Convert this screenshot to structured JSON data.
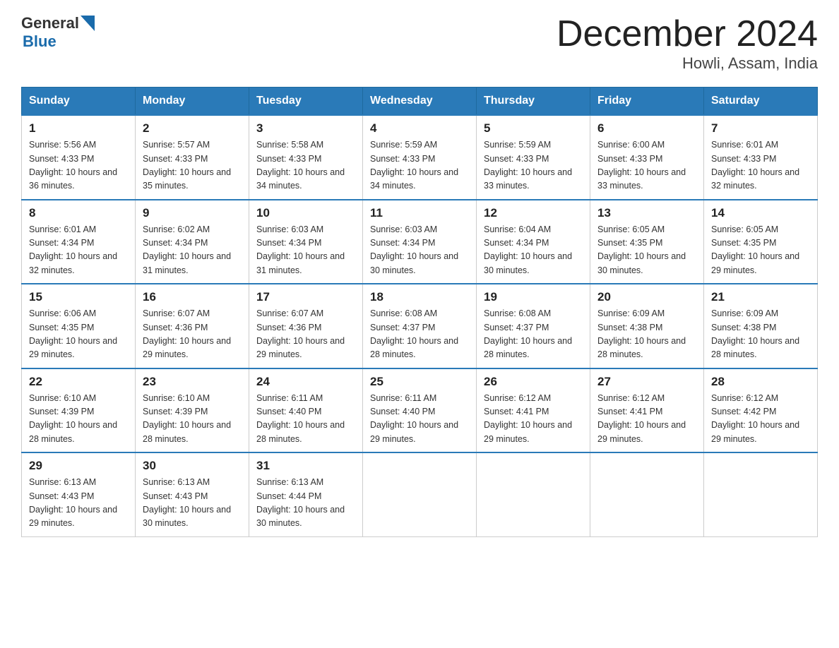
{
  "header": {
    "logo_general": "General",
    "logo_blue": "Blue",
    "month": "December 2024",
    "location": "Howli, Assam, India"
  },
  "days_of_week": [
    "Sunday",
    "Monday",
    "Tuesday",
    "Wednesday",
    "Thursday",
    "Friday",
    "Saturday"
  ],
  "weeks": [
    [
      {
        "day": 1,
        "sunrise": "5:56 AM",
        "sunset": "4:33 PM",
        "daylight": "10 hours and 36 minutes."
      },
      {
        "day": 2,
        "sunrise": "5:57 AM",
        "sunset": "4:33 PM",
        "daylight": "10 hours and 35 minutes."
      },
      {
        "day": 3,
        "sunrise": "5:58 AM",
        "sunset": "4:33 PM",
        "daylight": "10 hours and 34 minutes."
      },
      {
        "day": 4,
        "sunrise": "5:59 AM",
        "sunset": "4:33 PM",
        "daylight": "10 hours and 34 minutes."
      },
      {
        "day": 5,
        "sunrise": "5:59 AM",
        "sunset": "4:33 PM",
        "daylight": "10 hours and 33 minutes."
      },
      {
        "day": 6,
        "sunrise": "6:00 AM",
        "sunset": "4:33 PM",
        "daylight": "10 hours and 33 minutes."
      },
      {
        "day": 7,
        "sunrise": "6:01 AM",
        "sunset": "4:33 PM",
        "daylight": "10 hours and 32 minutes."
      }
    ],
    [
      {
        "day": 8,
        "sunrise": "6:01 AM",
        "sunset": "4:34 PM",
        "daylight": "10 hours and 32 minutes."
      },
      {
        "day": 9,
        "sunrise": "6:02 AM",
        "sunset": "4:34 PM",
        "daylight": "10 hours and 31 minutes."
      },
      {
        "day": 10,
        "sunrise": "6:03 AM",
        "sunset": "4:34 PM",
        "daylight": "10 hours and 31 minutes."
      },
      {
        "day": 11,
        "sunrise": "6:03 AM",
        "sunset": "4:34 PM",
        "daylight": "10 hours and 30 minutes."
      },
      {
        "day": 12,
        "sunrise": "6:04 AM",
        "sunset": "4:34 PM",
        "daylight": "10 hours and 30 minutes."
      },
      {
        "day": 13,
        "sunrise": "6:05 AM",
        "sunset": "4:35 PM",
        "daylight": "10 hours and 30 minutes."
      },
      {
        "day": 14,
        "sunrise": "6:05 AM",
        "sunset": "4:35 PM",
        "daylight": "10 hours and 29 minutes."
      }
    ],
    [
      {
        "day": 15,
        "sunrise": "6:06 AM",
        "sunset": "4:35 PM",
        "daylight": "10 hours and 29 minutes."
      },
      {
        "day": 16,
        "sunrise": "6:07 AM",
        "sunset": "4:36 PM",
        "daylight": "10 hours and 29 minutes."
      },
      {
        "day": 17,
        "sunrise": "6:07 AM",
        "sunset": "4:36 PM",
        "daylight": "10 hours and 29 minutes."
      },
      {
        "day": 18,
        "sunrise": "6:08 AM",
        "sunset": "4:37 PM",
        "daylight": "10 hours and 28 minutes."
      },
      {
        "day": 19,
        "sunrise": "6:08 AM",
        "sunset": "4:37 PM",
        "daylight": "10 hours and 28 minutes."
      },
      {
        "day": 20,
        "sunrise": "6:09 AM",
        "sunset": "4:38 PM",
        "daylight": "10 hours and 28 minutes."
      },
      {
        "day": 21,
        "sunrise": "6:09 AM",
        "sunset": "4:38 PM",
        "daylight": "10 hours and 28 minutes."
      }
    ],
    [
      {
        "day": 22,
        "sunrise": "6:10 AM",
        "sunset": "4:39 PM",
        "daylight": "10 hours and 28 minutes."
      },
      {
        "day": 23,
        "sunrise": "6:10 AM",
        "sunset": "4:39 PM",
        "daylight": "10 hours and 28 minutes."
      },
      {
        "day": 24,
        "sunrise": "6:11 AM",
        "sunset": "4:40 PM",
        "daylight": "10 hours and 28 minutes."
      },
      {
        "day": 25,
        "sunrise": "6:11 AM",
        "sunset": "4:40 PM",
        "daylight": "10 hours and 29 minutes."
      },
      {
        "day": 26,
        "sunrise": "6:12 AM",
        "sunset": "4:41 PM",
        "daylight": "10 hours and 29 minutes."
      },
      {
        "day": 27,
        "sunrise": "6:12 AM",
        "sunset": "4:41 PM",
        "daylight": "10 hours and 29 minutes."
      },
      {
        "day": 28,
        "sunrise": "6:12 AM",
        "sunset": "4:42 PM",
        "daylight": "10 hours and 29 minutes."
      }
    ],
    [
      {
        "day": 29,
        "sunrise": "6:13 AM",
        "sunset": "4:43 PM",
        "daylight": "10 hours and 29 minutes."
      },
      {
        "day": 30,
        "sunrise": "6:13 AM",
        "sunset": "4:43 PM",
        "daylight": "10 hours and 30 minutes."
      },
      {
        "day": 31,
        "sunrise": "6:13 AM",
        "sunset": "4:44 PM",
        "daylight": "10 hours and 30 minutes."
      },
      null,
      null,
      null,
      null
    ]
  ]
}
